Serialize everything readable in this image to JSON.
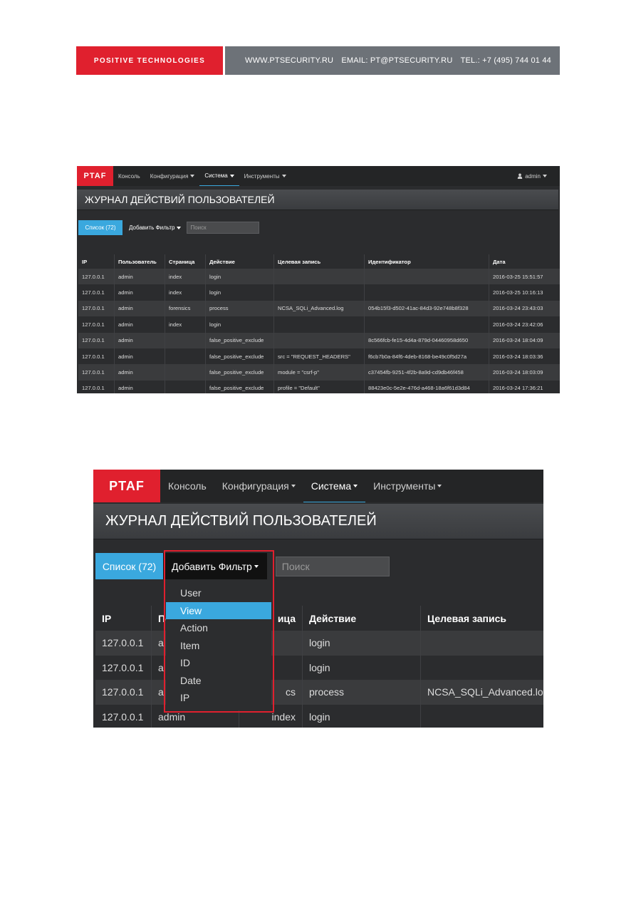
{
  "header": {
    "brand": "POSITIVE TECHNOLOGIES",
    "website": "WWW.PTSECURITY.RU",
    "email": "EMAIL: PT@PTSECURITY.RU",
    "phone": "TEL.: +7 (495) 744 01 44"
  },
  "app": {
    "logo": "PTAF",
    "nav": [
      "Консоль",
      "Конфигурация",
      "Система",
      "Инструменты"
    ],
    "active_nav": "Система",
    "user": "admin",
    "page_title": "ЖУРНАЛ ДЕЙСТВИЙ ПОЛЬЗОВАТЕЛЕЙ",
    "list_button": "Список (72)",
    "filter_button": "Добавить Фильтр",
    "search_placeholder": "Поиск",
    "columns": [
      "IP",
      "Пользователь",
      "Страница",
      "Действие",
      "Целевая запись",
      "Идентификатор",
      "Дата"
    ]
  },
  "screenshot1": {
    "rows": [
      [
        "127.0.0.1",
        "admin",
        "index",
        "login",
        "",
        "",
        "2016-03-25 15:51:57"
      ],
      [
        "127.0.0.1",
        "admin",
        "index",
        "login",
        "",
        "",
        "2016-03-25 10:16:13"
      ],
      [
        "127.0.0.1",
        "admin",
        "forensics",
        "process",
        "NCSA_SQLi_Advanced.log",
        "054b15f3-d502-41ac-84d3-92e748b8f328",
        "2016-03-24 23:43:03"
      ],
      [
        "127.0.0.1",
        "admin",
        "index",
        "login",
        "",
        "",
        "2016-03-24 23:42:06"
      ],
      [
        "127.0.0.1",
        "admin",
        "",
        "false_positive_exclude",
        "",
        "8c566fcb-fe15-4d4a-879d-04460958d650",
        "2016-03-24 18:04:09"
      ],
      [
        "127.0.0.1",
        "admin",
        "",
        "false_positive_exclude",
        "src = \"REQUEST_HEADERS\"",
        "f6cb7b0a-84f6-4deb-8168-be49c0f5d27a",
        "2016-03-24 18:03:36"
      ],
      [
        "127.0.0.1",
        "admin",
        "",
        "false_positive_exclude",
        "module = \"csrf-p\"",
        "c37454fb-9251-4f2b-8a9d-cd9db46f458",
        "2016-03-24 18:03:09"
      ],
      [
        "127.0.0.1",
        "admin",
        "",
        "false_positive_exclude",
        "profile = \"Default\"",
        "88423e0c-5e2e-476d-a468-18a6f61d3d84",
        "2016-03-24 17:36:21"
      ]
    ]
  },
  "screenshot2": {
    "visible_columns": [
      "IP",
      "По",
      "ица",
      "Действие",
      "Целевая запись"
    ],
    "rows": [
      [
        "127.0.0.1",
        "a",
        "",
        "login",
        ""
      ],
      [
        "127.0.0.1",
        "a",
        "",
        "login",
        ""
      ],
      [
        "127.0.0.1",
        "a",
        "cs",
        "process",
        "NCSA_SQLi_Advanced.log"
      ],
      [
        "127.0.0.1",
        "admin",
        "index",
        "login",
        ""
      ]
    ],
    "dropdown_items": [
      "User",
      "View",
      "Action",
      "Item",
      "ID",
      "Date",
      "IP"
    ],
    "dropdown_active": "View"
  },
  "colors": {
    "brand_red": "#e0202e",
    "accent_blue": "#3aa8de",
    "dark_bg": "#2b2c2e",
    "banner_gray": "#6d7278"
  }
}
